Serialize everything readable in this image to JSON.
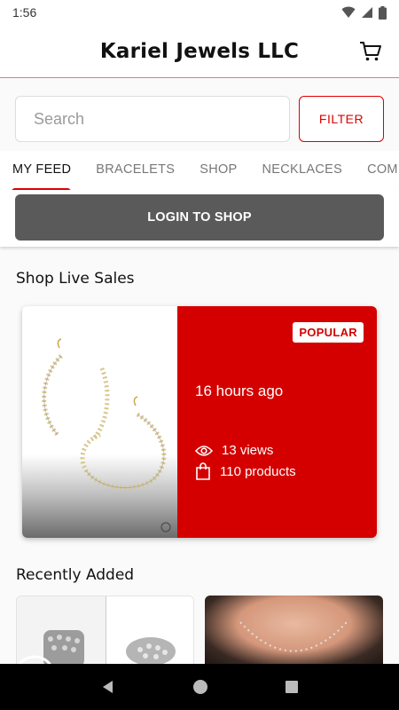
{
  "status_bar": {
    "time": "1:56"
  },
  "header": {
    "title": "Kariel Jewels LLC"
  },
  "search": {
    "placeholder": "Search",
    "filter_label": "FILTER"
  },
  "tabs": [
    {
      "label": "MY FEED",
      "active": true
    },
    {
      "label": "BRACELETS",
      "active": false
    },
    {
      "label": "SHOP",
      "active": false
    },
    {
      "label": "NECKLACES",
      "active": false
    },
    {
      "label": "COM",
      "active": false
    }
  ],
  "login": {
    "label": "LOGIN TO SHOP"
  },
  "live_sales": {
    "title": "Shop Live Sales",
    "card": {
      "badge": "POPULAR",
      "time": "16 hours ago",
      "views": "13 views",
      "products": "110 products"
    }
  },
  "recently_added": {
    "title": "Recently Added"
  },
  "colors": {
    "accent": "#d40000",
    "login_button": "#5a5a5a"
  }
}
